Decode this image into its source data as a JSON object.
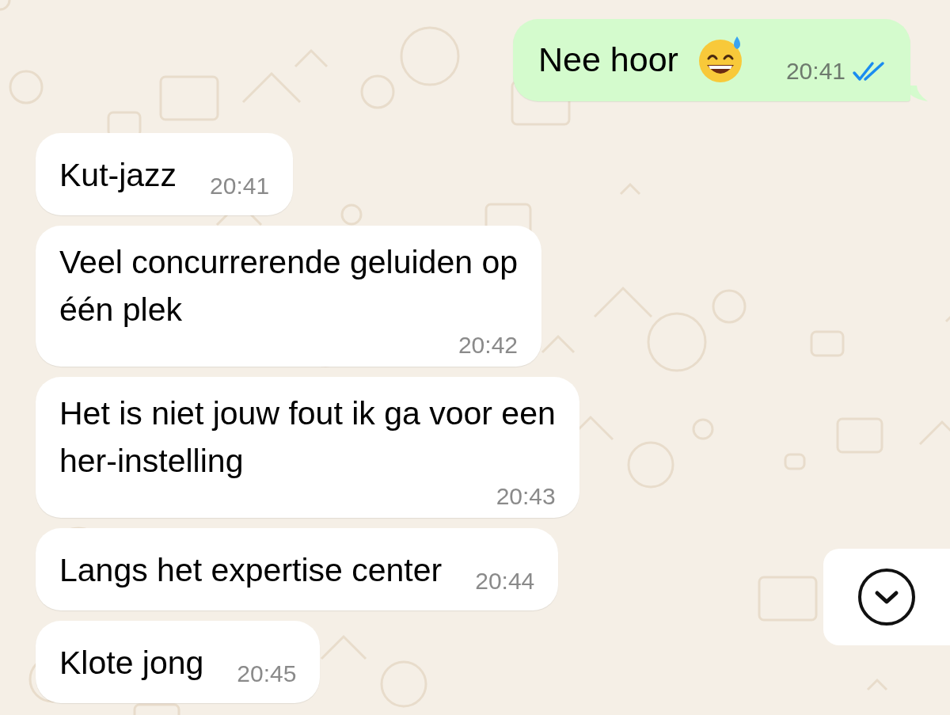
{
  "messages": [
    {
      "kind": "outgoing",
      "lines": [
        "Nee hoor"
      ],
      "emoji": true,
      "time": "20:41",
      "read": true
    },
    {
      "kind": "incoming",
      "lines": [
        "Kut-jazz"
      ],
      "time": "20:41"
    },
    {
      "kind": "incoming",
      "lines": [
        "Veel concurrerende geluiden op",
        "één plek"
      ],
      "time": "20:42"
    },
    {
      "kind": "incoming",
      "lines": [
        "Het is niet jouw fout ik ga voor een",
        "her-instelling"
      ],
      "time": "20:43"
    },
    {
      "kind": "incoming",
      "lines": [
        "Langs het expertise center"
      ],
      "time": "20:44"
    },
    {
      "kind": "incoming",
      "lines": [
        "Klote jong"
      ],
      "time": "20:45"
    }
  ]
}
